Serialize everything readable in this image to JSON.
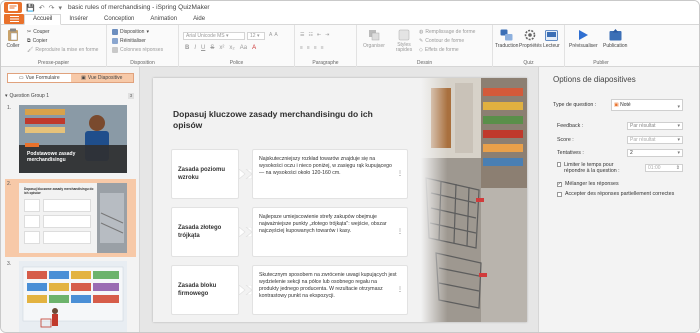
{
  "window": {
    "title": "basic rules of merchandising - iSpring QuizMaker"
  },
  "tabs": [
    "Accueil",
    "Insérer",
    "Conception",
    "Animation",
    "Aide"
  ],
  "ribbon": {
    "clipboard": {
      "paste": "Coller",
      "cut": "Couper",
      "copy": "Copier",
      "format": "Reproduire la mise en forme",
      "label": "Presse-papier"
    },
    "layout": {
      "layout": "Disposition",
      "reset": "Réinitialiser",
      "columns": "Colonnes réponses",
      "label": "Disposition"
    },
    "font": {
      "family": "Arial Unicode MS",
      "size": "12",
      "label": "Police"
    },
    "paragraph": {
      "label": "Paragraphe"
    },
    "design": {
      "organize": "Organiser",
      "styles": "Styles rapides",
      "fill": "Remplissage de forme",
      "outline": "Contour de forme",
      "effects": "Effets de forme",
      "label": "Dessin"
    },
    "quiz": {
      "translate": "Traduction",
      "properties": "Propriétés",
      "player": "Lecteur",
      "label": "Quiz"
    },
    "publish": {
      "preview": "Prévisualiser",
      "publication": "Publication",
      "label": "Publier"
    }
  },
  "left_panel": {
    "view_form": "Vue Formulaire",
    "view_slide": "Vue Diapositive",
    "group": "Question Group 1",
    "group_count": "3",
    "slides": [
      {
        "number": "1.",
        "thumb_title": "Podstawowe zasady merchandisingu"
      },
      {
        "number": "2.",
        "thumb_title": "Dopasuj kluczowe zasady merchandisingu do ich opisów"
      },
      {
        "number": "3.",
        "thumb_title": ""
      }
    ]
  },
  "slide": {
    "title": "Dopasuj kluczowe zasady merchandisingu do ich opisów",
    "pairs": [
      {
        "term": "Zasada poziomu wzroku",
        "description": "Najskuteczniejszy rozkład towarów znajduje się na wysokości oczu i nieco poniżej, w zasięgu rąk kupującego — na wysokości około 120-160 cm."
      },
      {
        "term": "Zasada złotego trójkąta",
        "description": "Najlepsze umiejscowienie strefy zakupów obejmuje najważniejsze punkty „złotego trójkąta\": wejście, obszar najczęściej kupowanych towarów i kasy."
      },
      {
        "term": "Zasada bloku firmowego",
        "description": "Skutecznym sposobem na zwrócenie uwagi kupujących jest wydzielenie sekcji na półce lub osobnego regału na produkty jednego producenta. W rezultacie otrzymasz kontrastowy punkt na ekspozycji."
      }
    ]
  },
  "options": {
    "title": "Options de diapositives",
    "question_type_label": "Type de question :",
    "question_type_value": "Noté",
    "feedback_label": "Feedback :",
    "feedback_value": "Par résultat",
    "score_label": "Score :",
    "score_value": "Par résultat",
    "attempts_label": "Tentatives :",
    "attempts_value": "2",
    "limit_time": "Limiter le temps pour répondre à la question :",
    "time_value": "01:00",
    "shuffle": "Mélanger les réponses",
    "accept_partial": "Accepter des réponses partiellement correctes"
  },
  "colors": {
    "accent": "#e9722c",
    "selection": "#f7c9a8"
  }
}
